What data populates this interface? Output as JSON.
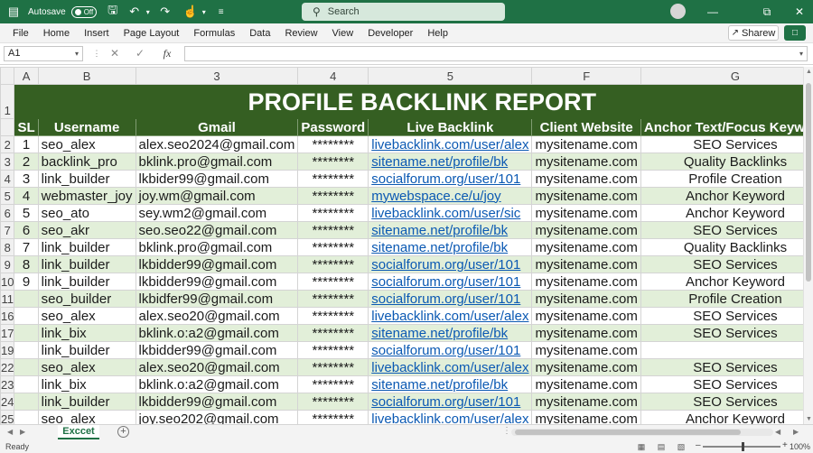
{
  "titlebar": {
    "autosave_label": "Autosave",
    "autosave_state": "Off",
    "search_placeholder": "Search"
  },
  "menu": [
    "File",
    "Home",
    "Insert",
    "Page Layout",
    "Formulas",
    "Data",
    "Review",
    "View",
    "Developer",
    "Help"
  ],
  "share_label": "Sharew",
  "formula_bar": {
    "name_box": "A1",
    "fx": "fx",
    "formula": ""
  },
  "columns": [
    "A",
    "B",
    "3",
    "4",
    "5",
    "F",
    "G"
  ],
  "report_title": "PROFILE BACKLINK REPORT",
  "headers": [
    "SL",
    "Username",
    "Gmail",
    "Password",
    "Live Backlink",
    "Client Website",
    "Anchor Text/Focus Keyword"
  ],
  "rows": [
    {
      "row": "2",
      "sl": "1",
      "user": "seo_alex",
      "gmail": "alex.seo2024@gmail.com",
      "pw": "********",
      "link": "livebacklink.com/user/alex",
      "site": "mysitename.com",
      "anchor": "SEO Services"
    },
    {
      "row": "3",
      "sl": "2",
      "user": "backlink_pro",
      "gmail": "bklink.pro@gmail.com",
      "pw": "********",
      "link": "sitename.net/profile/bk",
      "site": "mysitename.com",
      "anchor": "Quality Backlinks"
    },
    {
      "row": "4",
      "sl": "3",
      "user": "link_builder",
      "gmail": "lkbider99@gmail.com",
      "pw": "********",
      "link": "socialforum.org/user/101",
      "site": "mysitename.com",
      "anchor": "Profile Creation"
    },
    {
      "row": "5",
      "sl": "4",
      "user": "webmaster_joy",
      "gmail": "joy.wm@gmail.com",
      "pw": "********",
      "link": "mywebspace.ce/u/joy",
      "site": "mysitename.com",
      "anchor": "Anchor Keyword"
    },
    {
      "row": "6",
      "sl": "5",
      "user": "seo_ato",
      "gmail": "sey.wm2@gmail.com",
      "pw": "********",
      "link": "livebacklink.com/user/sic",
      "site": "mysitename.com",
      "anchor": "Anchor Keyword"
    },
    {
      "row": "7",
      "sl": "6",
      "user": "seo_akr",
      "gmail": "seo.seo22@gmail.com",
      "pw": "********",
      "link": "sitename.net/profile/bk",
      "site": "mysitename.com",
      "anchor": "SEO Services"
    },
    {
      "row": "8",
      "sl": "7",
      "user": "link_builder",
      "gmail": "bklink.pro@gmail.com",
      "pw": "********",
      "link": "sitename.net/profile/bk",
      "site": "mysitename.com",
      "anchor": "Quality Backlinks"
    },
    {
      "row": "9",
      "sl": "8",
      "user": "link_builder",
      "gmail": "lkbidder99@gmail.com",
      "pw": "********",
      "link": "socialforum.org/user/101",
      "site": "mysitename.com",
      "anchor": "SEO Services"
    },
    {
      "row": "10",
      "sl": "9",
      "user": "link_builder",
      "gmail": "lkbidder99@gmail.com",
      "pw": "********",
      "link": "socialforum.org/user/101",
      "site": "mysitename.com",
      "anchor": "Anchor Keyword"
    },
    {
      "row": "11",
      "sl": "",
      "user": "seo_builder",
      "gmail": "lkbidfer99@gmail.com",
      "pw": "********",
      "link": "socialforum.org/user/101",
      "site": "mysitename.com",
      "anchor": "Profile Creation"
    },
    {
      "row": "16",
      "sl": "",
      "user": "seo_alex",
      "gmail": "alex.seo20@gmail.com",
      "pw": "********",
      "link": "livebacklink.com/user/alex",
      "site": "mysitename.com",
      "anchor": "SEO Services"
    },
    {
      "row": "17",
      "sl": "",
      "user": "link_bix",
      "gmail": "bklink.o:a2@gmail.com",
      "pw": "********",
      "link": "sitename.net/profile/bk",
      "site": "mysitename.com",
      "anchor": "SEO Services"
    },
    {
      "row": "19",
      "sl": "",
      "user": "link_builder",
      "gmail": "lkbidder99@gmail.com",
      "pw": "********",
      "link": "socialforum.org/user/101",
      "site": "mysitename.com",
      "anchor": ""
    },
    {
      "row": "22",
      "sl": "",
      "user": "seo_alex",
      "gmail": "alex.seo20@gmail.com",
      "pw": "********",
      "link": "livebacklink.com/user/alex",
      "site": "mysitename.com",
      "anchor": "SEO Services"
    },
    {
      "row": "23",
      "sl": "",
      "user": "link_bix",
      "gmail": "bklink.o:a2@gmail.com",
      "pw": "********",
      "link": "sitename.net/profile/bk",
      "site": "mysitename.com",
      "anchor": "SEO Services"
    },
    {
      "row": "24",
      "sl": "",
      "user": "link_builder",
      "gmail": "lkbidder99@gmail.com",
      "pw": "********",
      "link": "socialforum.org/user/101",
      "site": "mysitename.com",
      "anchor": "SEO Services"
    },
    {
      "row": "25",
      "sl": "",
      "user": "seo_alex",
      "gmail": "joy.seo202@gmail.com",
      "pw": "********",
      "link": "livebacklink.com/user/alex",
      "site": "mysitename.com",
      "anchor": "Anchor Keyword"
    }
  ],
  "sheet_tab": "Exccet",
  "status": {
    "ready": "Ready",
    "zoom": "100%"
  },
  "colors": {
    "accent": "#1f7145",
    "header_fill": "#355f22",
    "band": "#e2efd9",
    "link": "#0b59b3"
  }
}
